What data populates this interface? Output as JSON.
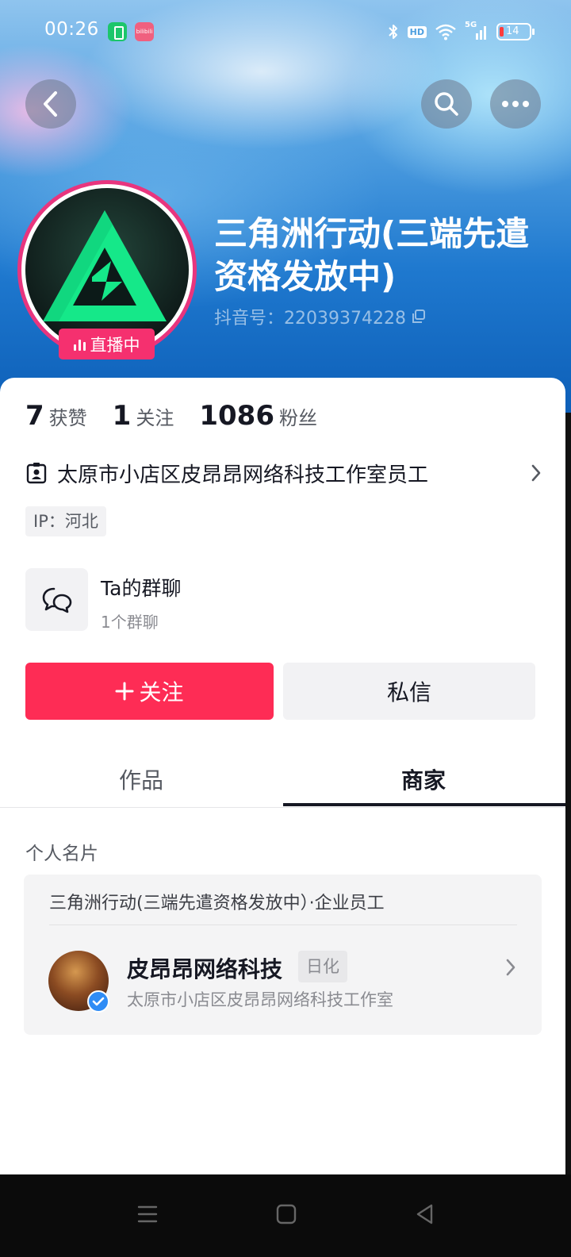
{
  "status_bar": {
    "time": "00:26",
    "app_icon_2_text": "bilibili",
    "network": "5G",
    "hd_label": "HD",
    "battery_level": "14"
  },
  "profile": {
    "name": "三角洲行动(三端先遣资格发放中)",
    "douyin_id": "抖音号：22039374228",
    "live_badge": "直播中",
    "stats": {
      "likes_count": "7",
      "likes_label": "获赞",
      "following_count": "1",
      "following_label": "关注",
      "followers_count": "1086",
      "followers_label": "粉丝"
    },
    "company": "太原市小店区皮昂昂网络科技工作室员工",
    "ip": "IP：河北"
  },
  "group_chat": {
    "title": "Ta的群聊",
    "subtitle": "1个群聊"
  },
  "actions": {
    "follow_label": "关注",
    "message_label": "私信"
  },
  "tabs": [
    {
      "label": "作品",
      "active": false
    },
    {
      "label": "商家",
      "active": true
    }
  ],
  "business_card": {
    "section_title": "个人名片",
    "role": "三角洲行动(三端先遣资格发放中）·企业员工",
    "company_name": "皮昂昂网络科技",
    "company_tag": "日化",
    "company_full_name": "太原市小店区皮昂昂网络科技工作室"
  },
  "colors": {
    "accent_red": "#fe2c55",
    "live_pink": "#f5306f",
    "verify_blue": "#2f8cf5"
  }
}
